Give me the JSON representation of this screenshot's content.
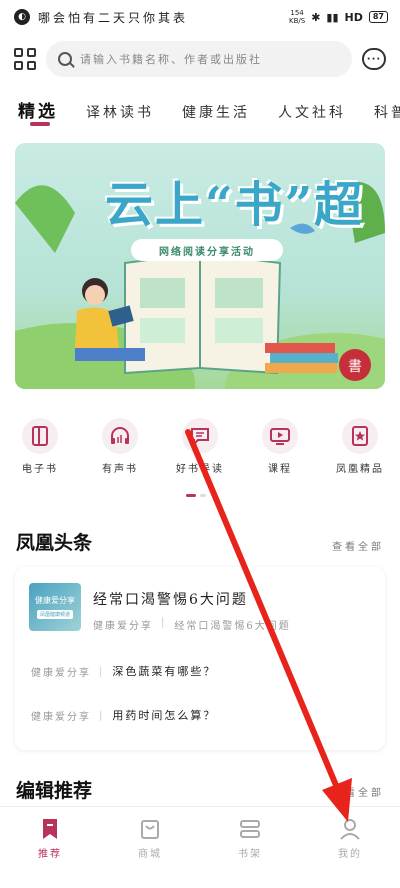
{
  "status_bar": {
    "logo_glyph": "◐",
    "marquee": "哪会怕有二天只你其表",
    "net_speed_value": "154",
    "net_speed_unit": "KB/S",
    "network": "HD",
    "battery": "87"
  },
  "header": {
    "search_placeholder": "请输入书籍名称、作者或出版社",
    "message_icon_text": "···"
  },
  "tabs": [
    "精选",
    "译林读书",
    "健康生活",
    "人文社科",
    "科普新"
  ],
  "banner": {
    "title": "云上“书”超",
    "subtitle": "网络阅读分享活动"
  },
  "quick_links": [
    {
      "label": "电子书",
      "icon": "book-icon"
    },
    {
      "label": "有声书",
      "icon": "headphones-icon"
    },
    {
      "label": "好书导读",
      "icon": "chat-icon"
    },
    {
      "label": "课程",
      "icon": "video-icon"
    },
    {
      "label": "凤凰精品",
      "icon": "star-book-icon"
    }
  ],
  "headlines": {
    "title": "凤凰头条",
    "more": "查看全部",
    "featured": {
      "thumb_title": "健康爱分享",
      "thumb_sub": "凤凰健康频道",
      "title": "经常口渴警惕6大问题",
      "source": "健康爱分享",
      "subtitle": "经常口渴警惕6大问题"
    },
    "items": [
      {
        "source": "健康爱分享",
        "title": "深色蔬菜有哪些？"
      },
      {
        "source": "健康爱分享",
        "title": "用药时间怎么算？"
      }
    ]
  },
  "recommend": {
    "title": "编辑推荐",
    "more": "查看全部"
  },
  "tabbar": [
    {
      "label": "推荐",
      "icon": "bookmark-icon",
      "active": true
    },
    {
      "label": "商城",
      "icon": "shopping-bag-icon",
      "active": false
    },
    {
      "label": "书架",
      "icon": "bookshelf-icon",
      "active": false
    },
    {
      "label": "我的",
      "icon": "person-icon",
      "active": false
    }
  ],
  "colors": {
    "accent": "#b8325a",
    "annotation_arrow": "#e8231c"
  }
}
